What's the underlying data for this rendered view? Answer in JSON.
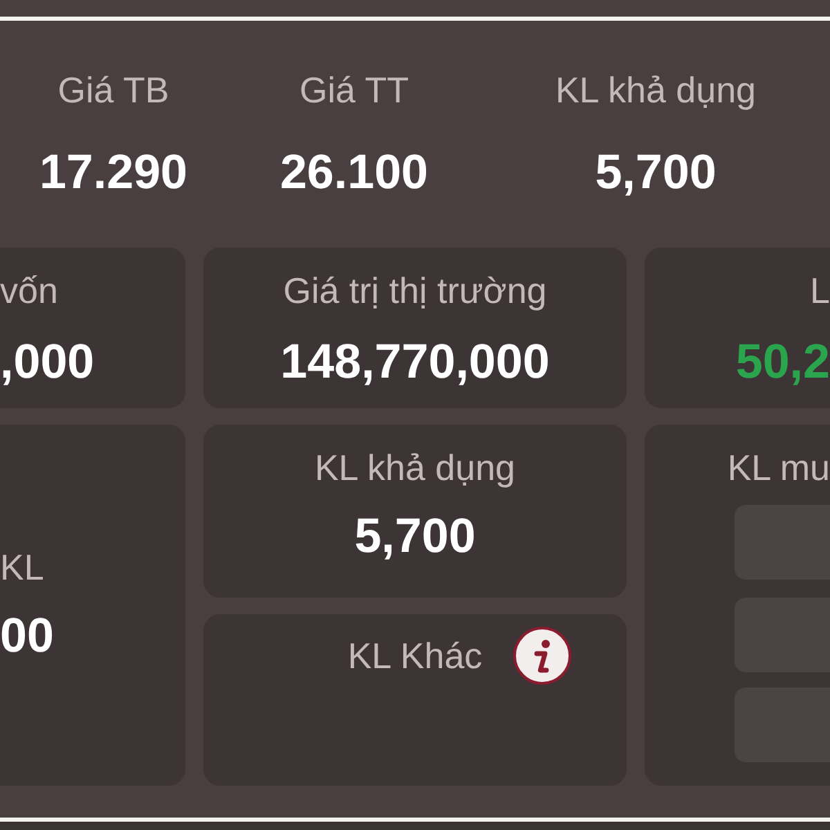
{
  "summary": [
    {
      "label": "Giá TB",
      "value": "17.290"
    },
    {
      "label": "Giá TT",
      "value": "26.100"
    },
    {
      "label": "KL khả dụng",
      "value": "5,700"
    }
  ],
  "cards": [
    {
      "label": "vốn",
      "value": ",000",
      "color": "#ffffff"
    },
    {
      "label": "Giá trị thị trường",
      "value": "148,770,000",
      "color": "#ffffff"
    },
    {
      "label": "L",
      "value": "50,2",
      "color": "#2aa54e"
    }
  ],
  "details": [
    {
      "kind": "value",
      "label": "KL",
      "value": "00"
    },
    {
      "kind": "value",
      "label": "KL khả dụng",
      "value": "5,700"
    },
    {
      "kind": "info",
      "label": "KL Khác"
    },
    {
      "kind": "tiles",
      "label": "KL mu"
    }
  ]
}
